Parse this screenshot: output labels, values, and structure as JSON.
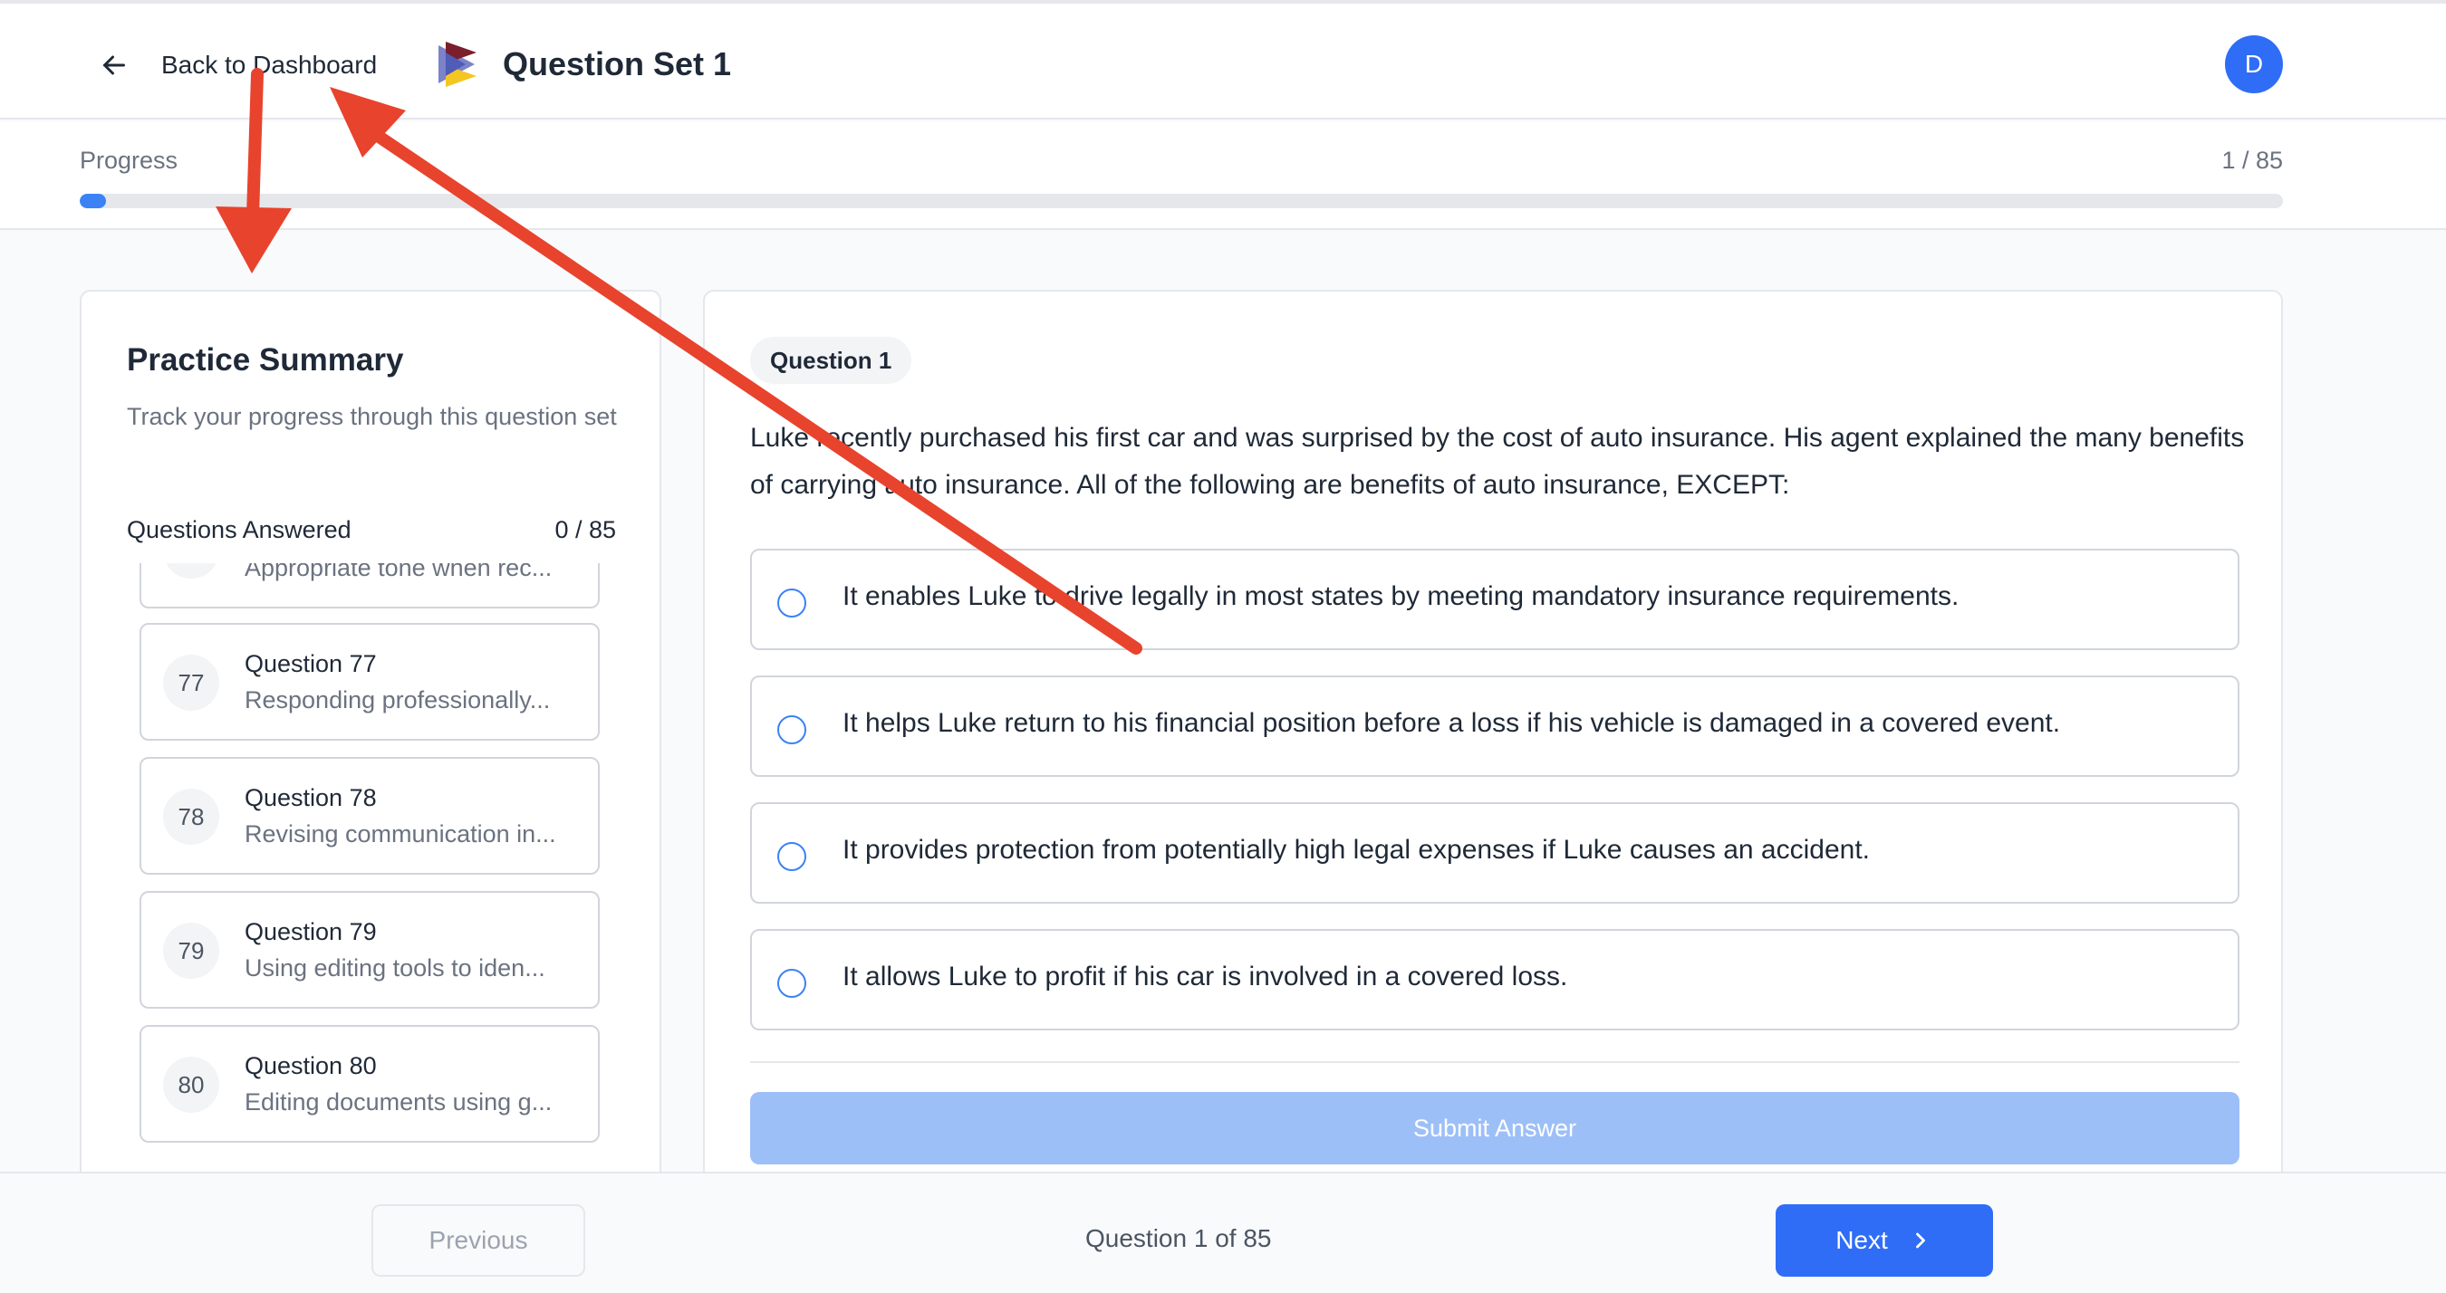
{
  "header": {
    "back_label": "Back to Dashboard",
    "title": "Question Set 1",
    "avatar_initial": "D",
    "icons": {
      "back": "arrow-left-icon",
      "brand": "brand-logo"
    }
  },
  "progress": {
    "label": "Progress",
    "count": "1 / 85",
    "fraction": 0.0118
  },
  "sidebar": {
    "title": "Practice Summary",
    "subtitle": "Track your progress through this question set",
    "answered_label": "Questions Answered",
    "answered_count": "0 / 85",
    "items": [
      {
        "num": "",
        "name": "",
        "desc": "Appropriate tone when rec..."
      },
      {
        "num": "77",
        "name": "Question 77",
        "desc": "Responding professionally..."
      },
      {
        "num": "78",
        "name": "Question 78",
        "desc": "Revising communication in..."
      },
      {
        "num": "79",
        "name": "Question 79",
        "desc": "Using editing tools to iden..."
      },
      {
        "num": "80",
        "name": "Question 80",
        "desc": "Editing documents using g..."
      }
    ]
  },
  "question": {
    "badge": "Question 1",
    "text": "Luke recently purchased his first car and was surprised by the cost of auto insurance. His agent explained the many benefits of carrying auto insurance. All of the following are benefits of auto insurance, EXCEPT:",
    "options": [
      "It enables Luke to drive legally in most states by meeting mandatory insurance requirements.",
      "It helps Luke return to his financial position before a loss if his vehicle is damaged in a covered event.",
      "It provides protection from potentially high legal expenses if Luke causes an accident.",
      "It allows Luke to profit if his car is involved in a covered loss."
    ],
    "submit_label": "Submit Answer"
  },
  "footer": {
    "previous_label": "Previous",
    "counter": "Question 1 of 85",
    "next_label": "Next"
  },
  "colors": {
    "accent": "#2f6df6",
    "progress_fill": "#3b82f6",
    "submit_disabled": "#9dbff8",
    "annotation": "#e8432d"
  }
}
